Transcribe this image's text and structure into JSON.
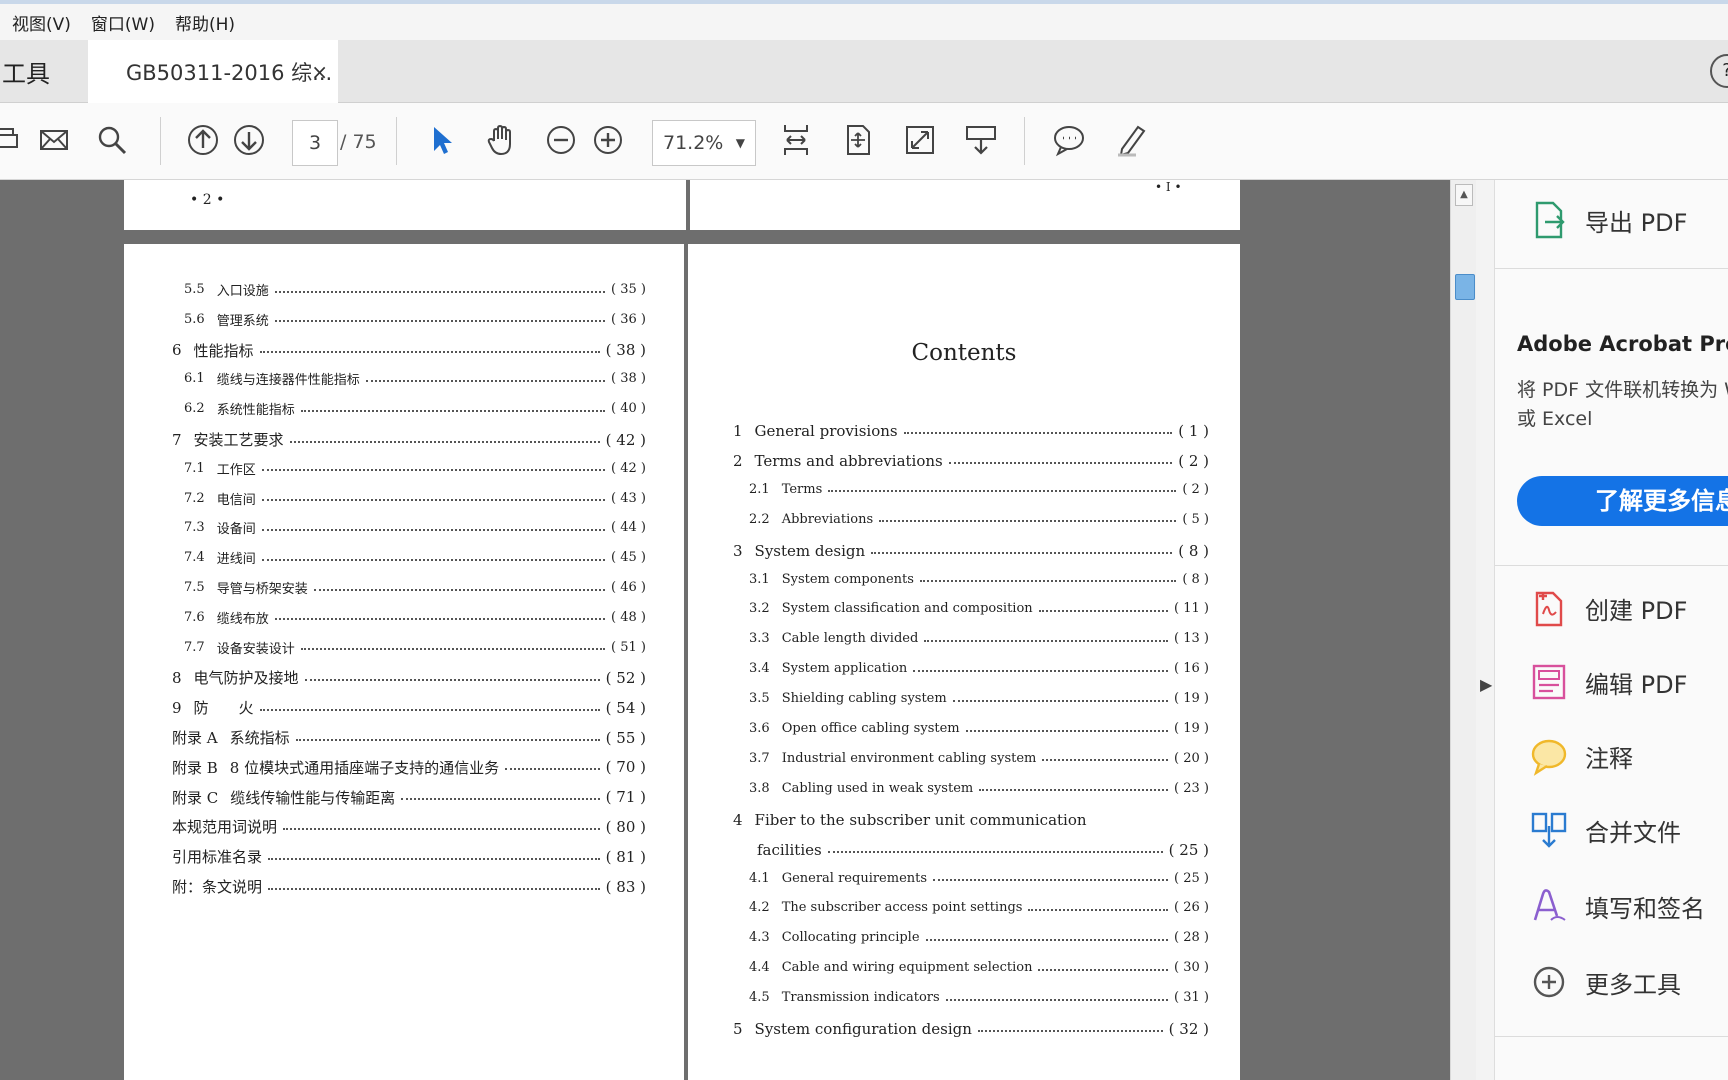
{
  "menu": {
    "items": [
      "视图(V)",
      "窗口(W)",
      "帮助(H)"
    ]
  },
  "tabs": {
    "tools": "工具",
    "doc": "GB50311-2016 综...",
    "close": "×",
    "help": "?"
  },
  "toolbar": {
    "page_current": "3",
    "page_total": "/ 75",
    "zoom": "71.2%"
  },
  "pages": {
    "top_left_number": "• 2 •",
    "top_right_mark": "• I •",
    "left_toc": [
      {
        "num": "5.5",
        "label": "入口设施",
        "page": "( 35 )",
        "indent": 1
      },
      {
        "num": "5.6",
        "label": "管理系统",
        "page": "( 36 )",
        "indent": 1
      },
      {
        "num": "6",
        "label": "性能指标",
        "page": "( 38 )",
        "indent": 0
      },
      {
        "num": "6.1",
        "label": "缆线与连接器件性能指标",
        "page": "( 38 )",
        "indent": 1
      },
      {
        "num": "6.2",
        "label": "系统性能指标",
        "page": "( 40 )",
        "indent": 1
      },
      {
        "num": "7",
        "label": "安装工艺要求",
        "page": "( 42 )",
        "indent": 0
      },
      {
        "num": "7.1",
        "label": "工作区",
        "page": "( 42 )",
        "indent": 1
      },
      {
        "num": "7.2",
        "label": "电信间",
        "page": "( 43 )",
        "indent": 1
      },
      {
        "num": "7.3",
        "label": "设备间",
        "page": "( 44 )",
        "indent": 1
      },
      {
        "num": "7.4",
        "label": "进线间",
        "page": "( 45 )",
        "indent": 1
      },
      {
        "num": "7.5",
        "label": "导管与桥架安装",
        "page": "( 46 )",
        "indent": 1
      },
      {
        "num": "7.6",
        "label": "缆线布放",
        "page": "( 48 )",
        "indent": 1
      },
      {
        "num": "7.7",
        "label": "设备安装设计",
        "page": "( 51 )",
        "indent": 1
      },
      {
        "num": "8",
        "label": "电气防护及接地",
        "page": "( 52 )",
        "indent": 0
      },
      {
        "num": "9",
        "label": "防　　火",
        "page": "( 54 )",
        "indent": 0
      },
      {
        "num": "附录 A",
        "label": "系统指标",
        "page": "( 55 )",
        "indent": 2
      },
      {
        "num": "附录 B",
        "label": "8 位模块式通用插座端子支持的通信业务",
        "page": "( 70 )",
        "indent": 2
      },
      {
        "num": "附录 C",
        "label": "缆线传输性能与传输距离",
        "page": "( 71 )",
        "indent": 2
      },
      {
        "num": "",
        "label": "本规范用词说明",
        "page": "( 80 )",
        "indent": 2
      },
      {
        "num": "",
        "label": "引用标准名录",
        "page": "( 81 )",
        "indent": 2
      },
      {
        "num": "",
        "label": "附：条文说明",
        "page": "( 83 )",
        "indent": 2
      }
    ],
    "contents_title": "Contents",
    "right_toc": [
      {
        "num": "1",
        "label": "General provisions",
        "page": "( 1 )",
        "indent": 0
      },
      {
        "num": "2",
        "label": "Terms and abbreviations",
        "page": "( 2 )",
        "indent": 0
      },
      {
        "num": "2.1",
        "label": "Terms",
        "page": "( 2 )",
        "indent": 1
      },
      {
        "num": "2.2",
        "label": "Abbreviations",
        "page": "( 5 )",
        "indent": 1
      },
      {
        "num": "3",
        "label": "System design",
        "page": "( 8 )",
        "indent": 0
      },
      {
        "num": "3.1",
        "label": "System components",
        "page": "( 8 )",
        "indent": 1
      },
      {
        "num": "3.2",
        "label": "System classification and composition",
        "page": "( 11 )",
        "indent": 1
      },
      {
        "num": "3.3",
        "label": "Cable length divided",
        "page": "( 13 )",
        "indent": 1
      },
      {
        "num": "3.4",
        "label": "System application",
        "page": "( 16 )",
        "indent": 1
      },
      {
        "num": "3.5",
        "label": "Shielding cabling system",
        "page": "( 19 )",
        "indent": 1
      },
      {
        "num": "3.6",
        "label": "Open office cabling system",
        "page": "( 19 )",
        "indent": 1
      },
      {
        "num": "3.7",
        "label": "Industrial environment cabling system",
        "page": "( 20 )",
        "indent": 1
      },
      {
        "num": "3.8",
        "label": "Cabling used in weak system",
        "page": "( 23 )",
        "indent": 1
      },
      {
        "num": "4",
        "label": "Fiber to the subscriber unit communication",
        "page": "",
        "indent": 0
      },
      {
        "num": "",
        "label": "facilities",
        "page": "( 25 )",
        "indent": 3
      },
      {
        "num": "4.1",
        "label": "General requirements",
        "page": "( 25 )",
        "indent": 1
      },
      {
        "num": "4.2",
        "label": "The subscriber access point settings",
        "page": "( 26 )",
        "indent": 1
      },
      {
        "num": "4.3",
        "label": "Collocating principle",
        "page": "( 28 )",
        "indent": 1
      },
      {
        "num": "4.4",
        "label": "Cable and wiring equipment selection",
        "page": "( 30 )",
        "indent": 1
      },
      {
        "num": "4.5",
        "label": "Transmission indicators",
        "page": "( 31 )",
        "indent": 1
      },
      {
        "num": "5",
        "label": "System configuration design",
        "page": "( 32 )",
        "indent": 0
      }
    ]
  },
  "right_panel": {
    "export": "导出 PDF",
    "promo_title": "Adobe Acrobat Pro DC",
    "promo_text": "将 PDF 文件联机转换为 Word 或 Excel",
    "promo_button": "了解更多信息",
    "create": "创建 PDF",
    "edit": "编辑 PDF",
    "comment": "注释",
    "combine": "合并文件",
    "fill_sign": "填写和签名",
    "more_tools": "更多工具"
  }
}
